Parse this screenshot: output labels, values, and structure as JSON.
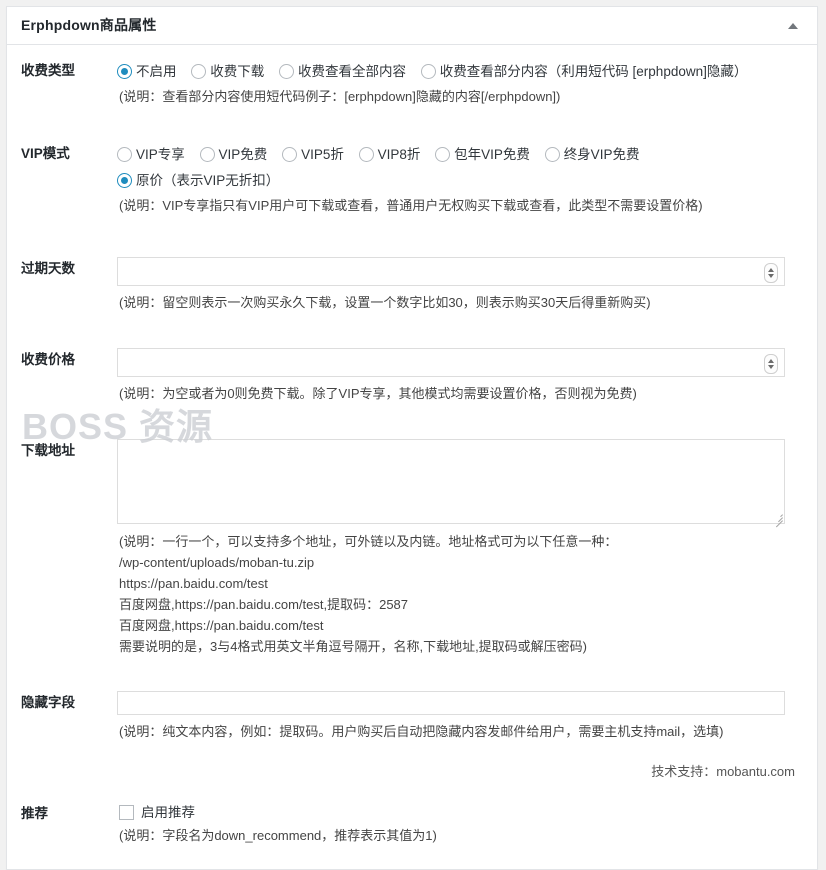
{
  "panel": {
    "title": "Erphpdown商品属性",
    "toggle_icon": "chevron-up-icon"
  },
  "watermark": {
    "text": "BOSS 资源"
  },
  "fields": {
    "charge_type": {
      "label": "收费类型",
      "options": [
        {
          "label": "不启用",
          "checked": true
        },
        {
          "label": "收费下载",
          "checked": false
        },
        {
          "label": "收费查看全部内容",
          "checked": false
        },
        {
          "label": "收费查看部分内容（利用短代码 [erphpdown]隐藏）",
          "checked": false
        }
      ],
      "hint": "(说明：查看部分内容使用短代码例子：[erphpdown]隐藏的内容[/erphpdown])"
    },
    "vip_mode": {
      "label": "VIP模式",
      "options": [
        {
          "label": "VIP专享",
          "checked": false
        },
        {
          "label": "VIP免费",
          "checked": false
        },
        {
          "label": "VIP5折",
          "checked": false
        },
        {
          "label": "VIP8折",
          "checked": false
        },
        {
          "label": "包年VIP免费",
          "checked": false
        },
        {
          "label": "终身VIP免费",
          "checked": false
        },
        {
          "label": "原价（表示VIP无折扣）",
          "checked": true
        }
      ],
      "hint": "(说明：VIP专享指只有VIP用户可下载或查看，普通用户无权购买下载或查看，此类型不需要设置价格)"
    },
    "expire_days": {
      "label": "过期天数",
      "value": "",
      "placeholder": "",
      "hint": "(说明：留空则表示一次购买永久下载，设置一个数字比如30，则表示购买30天后得重新购买)"
    },
    "price": {
      "label": "收费价格",
      "value": "",
      "placeholder": "",
      "hint": "(说明：为空或者为0则免费下载。除了VIP专享，其他模式均需要设置价格，否则视为免费)"
    },
    "download_url": {
      "label": "下载地址",
      "value": "",
      "placeholder": "",
      "hint_lines": [
        "(说明：一行一个，可以支持多个地址，可外链以及内链。地址格式可为以下任意一种：",
        "/wp-content/uploads/moban-tu.zip",
        "https://pan.baidu.com/test",
        "百度网盘,https://pan.baidu.com/test,提取码：2587",
        "百度网盘,https://pan.baidu.com/test",
        "需要说明的是，3与4格式用英文半角逗号隔开，名称,下载地址,提取码或解压密码)"
      ]
    },
    "hidden_field": {
      "label": "隐藏字段",
      "value": "",
      "placeholder": "",
      "hint": "(说明：纯文本内容，例如：提取码。用户购买后自动把隐藏内容发邮件给用户，需要主机支持mail，选填)"
    },
    "recommend": {
      "label": "推荐",
      "checkbox_label": "启用推荐",
      "checked": false,
      "hint": "(说明：字段名为down_recommend，推荐表示其值为1)"
    }
  },
  "credit": {
    "text": "技术支持：mobantu.com"
  },
  "colors": {
    "accent": "#1e8cbe",
    "panel_border": "#e2e4e7",
    "page_background": "#f1f1f1"
  }
}
